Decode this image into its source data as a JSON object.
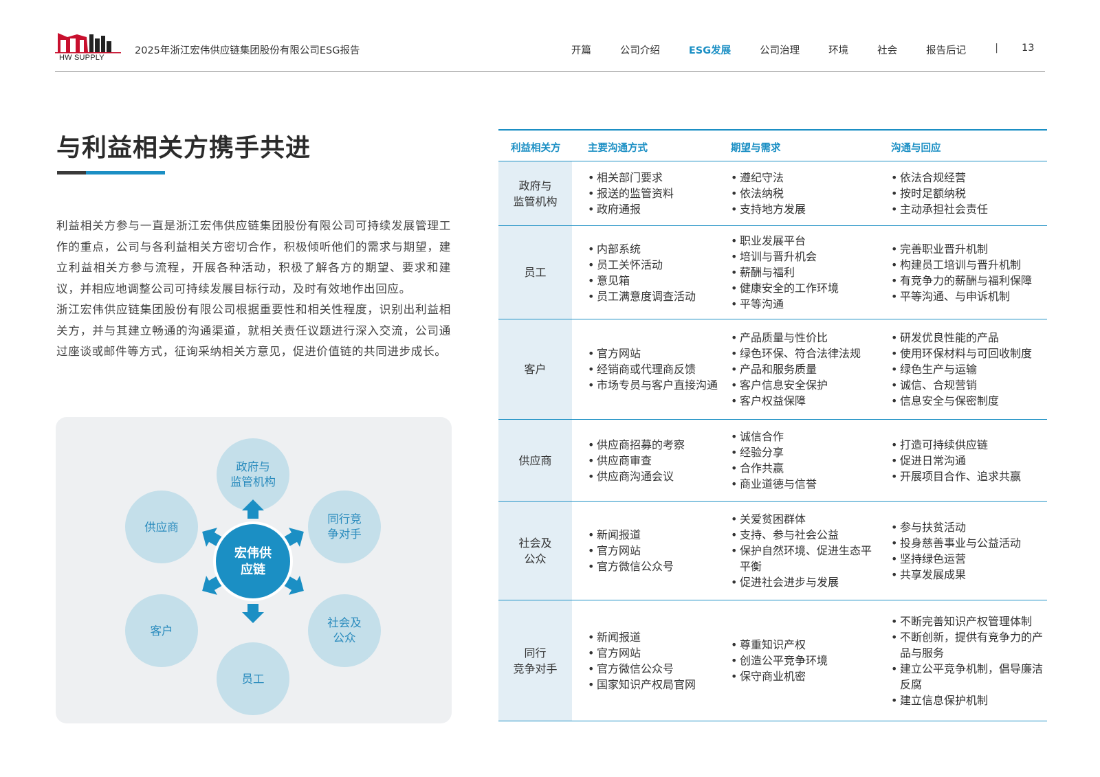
{
  "header": {
    "logo_text": "HW SUPPLY",
    "report_title": "2025年浙江宏伟供应链集团股份有限公司ESG报告",
    "nav": [
      "开篇",
      "公司介绍",
      "ESG发展",
      "公司治理",
      "环境",
      "社会",
      "报告后记"
    ],
    "nav_active_index": 2,
    "separator": "|",
    "page_number": "13"
  },
  "section": {
    "title": "与利益相关方携手共进",
    "paragraphs": [
      "利益相关方参与一直是浙江宏伟供应链集团股份有限公司可持续发展管理工作的重点，公司与各利益相关方密切合作，积极倾听他们的需求与期望，建立利益相关方参与流程，开展各种活动，积极了解各方的期望、要求和建议，并相应地调整公司可持续发展目标行动，及时有效地作出回应。",
      "浙江宏伟供应链集团股份有限公司根据重要性和相关性程度，识别出利益相关方，并与其建立畅通的沟通渠道，就相关责任议题进行深入交流，公司通过座谈或邮件等方式，征询采纳相关方意见，促进价值链的共同进步成长。"
    ]
  },
  "diagram": {
    "center": [
      "宏伟供",
      "应链"
    ],
    "nodes": [
      {
        "lines": [
          "政府与",
          "监管机构"
        ]
      },
      {
        "lines": [
          "同行竞",
          "争对手"
        ]
      },
      {
        "lines": [
          "社会及",
          "公众"
        ]
      },
      {
        "lines": [
          "员工"
        ]
      },
      {
        "lines": [
          "客户"
        ]
      },
      {
        "lines": [
          "供应商"
        ]
      }
    ],
    "colors": {
      "center": "#1b8fc4",
      "node": "#c4dfea",
      "node_text": "#2a8bbd",
      "arrow": "#1b8fc4"
    }
  },
  "table": {
    "headers": [
      "利益相关方",
      "主要沟通方式",
      "期望与需求",
      "沟通与回应"
    ],
    "rows": [
      {
        "label": [
          "政府与",
          "监管机构"
        ],
        "channels": [
          "相关部门要求",
          "报送的监管资料",
          "政府通报"
        ],
        "expectations": [
          "遵纪守法",
          "依法纳税",
          "支持地方发展"
        ],
        "responses": [
          "依法合规经营",
          "按时足额纳税",
          "主动承担社会责任"
        ]
      },
      {
        "label": [
          "员工"
        ],
        "channels": [
          "内部系统",
          "员工关怀活动",
          "意见箱",
          "员工满意度调查活动"
        ],
        "expectations": [
          "职业发展平台",
          "培训与晋升机会",
          "薪酬与福利",
          "健康安全的工作环境",
          "平等沟通"
        ],
        "responses": [
          "完善职业晋升机制",
          "构建员工培训与晋升机制",
          "有竞争力的薪酬与福利保障",
          "平等沟通、与申诉机制"
        ]
      },
      {
        "label": [
          "客户"
        ],
        "channels": [
          "官方网站",
          "经销商或代理商反馈",
          "市场专员与客户直接沟通"
        ],
        "expectations": [
          "产品质量与性价比",
          "绿色环保、符合法律法规",
          "产品和服务质量",
          "客户信息安全保护",
          "客户权益保障"
        ],
        "responses": [
          "研发优良性能的产品",
          "使用环保材料与可回收制度",
          "绿色生产与运输",
          "诚信、合规营销",
          "信息安全与保密制度"
        ]
      },
      {
        "label": [
          "供应商"
        ],
        "channels": [
          "供应商招募的考察",
          "供应商审查",
          "供应商沟通会议"
        ],
        "expectations": [
          "诚信合作",
          "经验分享",
          "合作共赢",
          "商业道德与信誉"
        ],
        "responses": [
          "打造可持续供应链",
          "促进日常沟通",
          "开展项目合作、追求共赢"
        ]
      },
      {
        "label": [
          "社会及",
          "公众"
        ],
        "channels": [
          "新闻报道",
          "官方网站",
          "官方微信公众号"
        ],
        "expectations": [
          "关爱贫困群体",
          "支持、参与社会公益",
          "保护自然环境、促进生态平平衡",
          "促进社会进步与发展"
        ],
        "responses": [
          "参与扶贫活动",
          "投身慈善事业与公益活动",
          "坚持绿色运营",
          "共享发展成果"
        ]
      },
      {
        "label": [
          "同行",
          "竞争对手"
        ],
        "channels": [
          "新闻报道",
          "官方网站",
          "官方微信公众号",
          "国家知识产权局官网"
        ],
        "expectations": [
          "尊重知识产权",
          "创造公平竞争环境",
          "保守商业机密"
        ],
        "responses": [
          "不断完善知识产权管理体制",
          "不断创新，提供有竞争力的产品与服务",
          "建立公平竞争机制，倡导廉洁反腐",
          "建立信息保护机制"
        ]
      }
    ]
  }
}
